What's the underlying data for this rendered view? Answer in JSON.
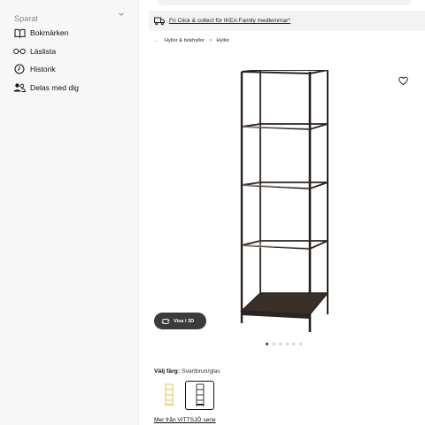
{
  "sidebar": {
    "header_label": "Sparat",
    "items": [
      {
        "label": "Bokmärken",
        "icon": "book-icon"
      },
      {
        "label": "Läslista",
        "icon": "glasses-icon"
      },
      {
        "label": "Historik",
        "icon": "clock-icon"
      },
      {
        "label": "Delas med dig",
        "icon": "shared-people-icon"
      }
    ]
  },
  "promo": {
    "text": "Fri Click & collect för IKEA Family medlemmar*",
    "icon": "truck-icon"
  },
  "breadcrumb": {
    "ellipsis": "...",
    "items": [
      "Hyllor & bokhyllor",
      "Hyllor"
    ],
    "separator": ">"
  },
  "product": {
    "image": "black-brown glass shelving unit",
    "favorite_icon": "heart-icon",
    "view3d_label": "Visa i 3D",
    "carousel_total": 6,
    "carousel_active": 1
  },
  "color": {
    "label": "Välj färg:",
    "value": "Svartbrun/glas",
    "swatches": [
      {
        "name": "yellow",
        "color": "#e9c94a",
        "selected": false
      },
      {
        "name": "black-brown",
        "color": "#2a2420",
        "selected": true
      }
    ]
  },
  "series_link": "Mer från VITTSJÖ serie"
}
